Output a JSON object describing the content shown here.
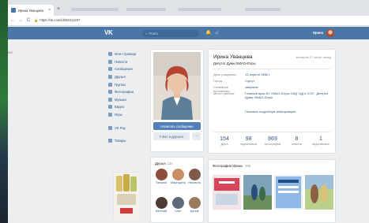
{
  "tab": {
    "title": "Ирина Уванцева",
    "close": "×"
  },
  "new_tab": "+",
  "nav": {
    "back": "←",
    "forward": "→",
    "reload": "C",
    "lock": "🔒",
    "url": "https://vk.com/id333311267"
  },
  "header": {
    "logo": "VK",
    "search_placeholder": "Поиск",
    "user_name": "Ирина"
  },
  "page_left_text": "DO",
  "sidebar": {
    "items": [
      {
        "label": "Моя страница"
      },
      {
        "label": "Новости"
      },
      {
        "label": "Сообщения"
      },
      {
        "label": "Друзья"
      },
      {
        "label": "Группы"
      },
      {
        "label": "Фотографии"
      },
      {
        "label": "Музыка"
      },
      {
        "label": "Видео"
      },
      {
        "label": "Игры"
      }
    ],
    "extra": [
      {
        "label": "VK Pay"
      },
      {
        "label": "Товары"
      }
    ]
  },
  "photo_card": {
    "message_button": "Написать сообщение",
    "friend_button": "У Вас в друзьях",
    "more_button": "···"
  },
  "friends": {
    "title": "Друзья",
    "count": "134",
    "items": [
      {
        "name": "Татьяна",
        "color": "#8a4e3a"
      },
      {
        "name": "Маргарита",
        "color": "#c98f63"
      },
      {
        "name": "Неонила",
        "color": "#7d5a4a"
      },
      {
        "name": "Евгений",
        "color": "#4d3a32"
      },
      {
        "name": "Олег",
        "color": "#5c6a7a"
      },
      {
        "name": "Артем",
        "color": "#9a7a5e"
      }
    ]
  },
  "profile": {
    "name": "Ирина Уванцева",
    "status": "Депутат Думы ХМАО-Югры",
    "online": "заходила 37 минут назад",
    "fields": [
      {
        "label": "День рождения:",
        "value": "13 апреля 1968 г."
      },
      {
        "label": "Город:",
        "value": "Сургут"
      },
      {
        "label": "Семейное положение:",
        "value": "замужем"
      },
      {
        "label": "Место работы:",
        "value": "Главный врач БУ ХМАО-Югры ОКД \"ЦД и ССХ\", Депутат Думы ХМАО-Югры"
      }
    ],
    "more_info": "Показать подробную информацию",
    "counters": [
      {
        "num": "154",
        "label": "друга"
      },
      {
        "num": "98",
        "label": "подписчиков"
      },
      {
        "num": "869",
        "label": "фотографий"
      },
      {
        "num": "8",
        "label": "отметок"
      },
      {
        "num": "1",
        "label": "видеозапись"
      }
    ]
  },
  "photos": {
    "title": "Фотографии Ирины",
    "count": "869"
  },
  "colors": {
    "vk_blue": "#4a76a8",
    "link": "#2a5885",
    "button": "#5181b8"
  }
}
